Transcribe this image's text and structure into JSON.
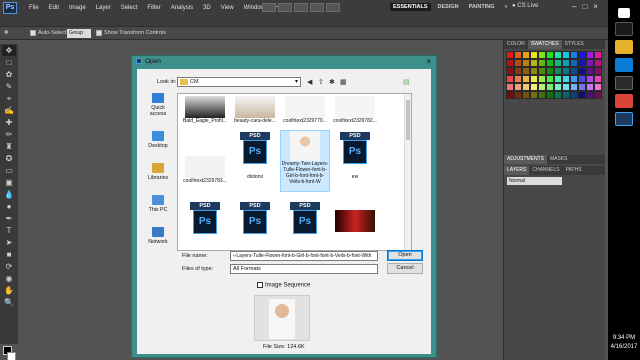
{
  "app": {
    "logo": "Ps",
    "menu": [
      "File",
      "Edit",
      "Image",
      "Layer",
      "Select",
      "Filter",
      "Analysis",
      "3D",
      "View",
      "Window",
      "Help"
    ],
    "workspaces": [
      "ESSENTIALS",
      "DESIGN",
      "PAINTING"
    ],
    "more_workspaces": "»",
    "cslive": "CS Live",
    "window_controls": [
      "–",
      "□",
      "×"
    ]
  },
  "options": {
    "auto_select_label": "Auto-Select:",
    "auto_select_value": "Group",
    "show_transform_label": "Show Transform Controls"
  },
  "panels": {
    "color_tabs": [
      "COLOR",
      "SWATCHES",
      "STYLES"
    ],
    "adjust_tabs": [
      "ADJUSTMENTS",
      "MASKS"
    ],
    "layer_tabs": [
      "LAYERS",
      "CHANNELS",
      "PATHS"
    ],
    "blend_mode": "Normal"
  },
  "dialog": {
    "title": "Open",
    "close": "×",
    "look_in_label": "Look in:",
    "look_in_value": "CM",
    "places": [
      {
        "label": "Quick access",
        "color": "#2f7ed8"
      },
      {
        "label": "Desktop",
        "color": "#3a8ee0"
      },
      {
        "label": "Libraries",
        "color": "#d9a53a"
      },
      {
        "label": "This PC",
        "color": "#4a90d9"
      },
      {
        "label": "Network",
        "color": "#3a7ac0"
      }
    ],
    "files_row1": [
      "Bald_Eagle_Profil...",
      "beauty-cara-dele...",
      "coolhtext2329779...",
      "coolhtext2329782..."
    ],
    "files_row2": [
      "coolhtext2329783...",
      "distorsi",
      "Dreamy-Two-Layers-Tulle-Flower-font-b-Girl-b-font-font-b-Veils-b-font-W",
      "ew"
    ],
    "psd_top": "PSD",
    "psd_mark": "Ps",
    "file_name_label": "File name:",
    "file_name_value": "‹-Layers-Tulle-Flower-font-b-Girl-b-font-font-b-Veils-b-font-With",
    "files_of_type_label": "Files of type:",
    "files_of_type_value": "All Formats",
    "open_label": "Open",
    "cancel_label": "Cancel",
    "image_sequence_label": "Image Sequence",
    "file_size": "File Size: 124.6K"
  },
  "taskbar": {
    "time": "9:34 PM",
    "date": "4/16/2017"
  },
  "colors": {
    "dialog_frame": "#3d8f8a",
    "ps_blue": "#4fb0ff",
    "selection": "#cce8ff"
  }
}
